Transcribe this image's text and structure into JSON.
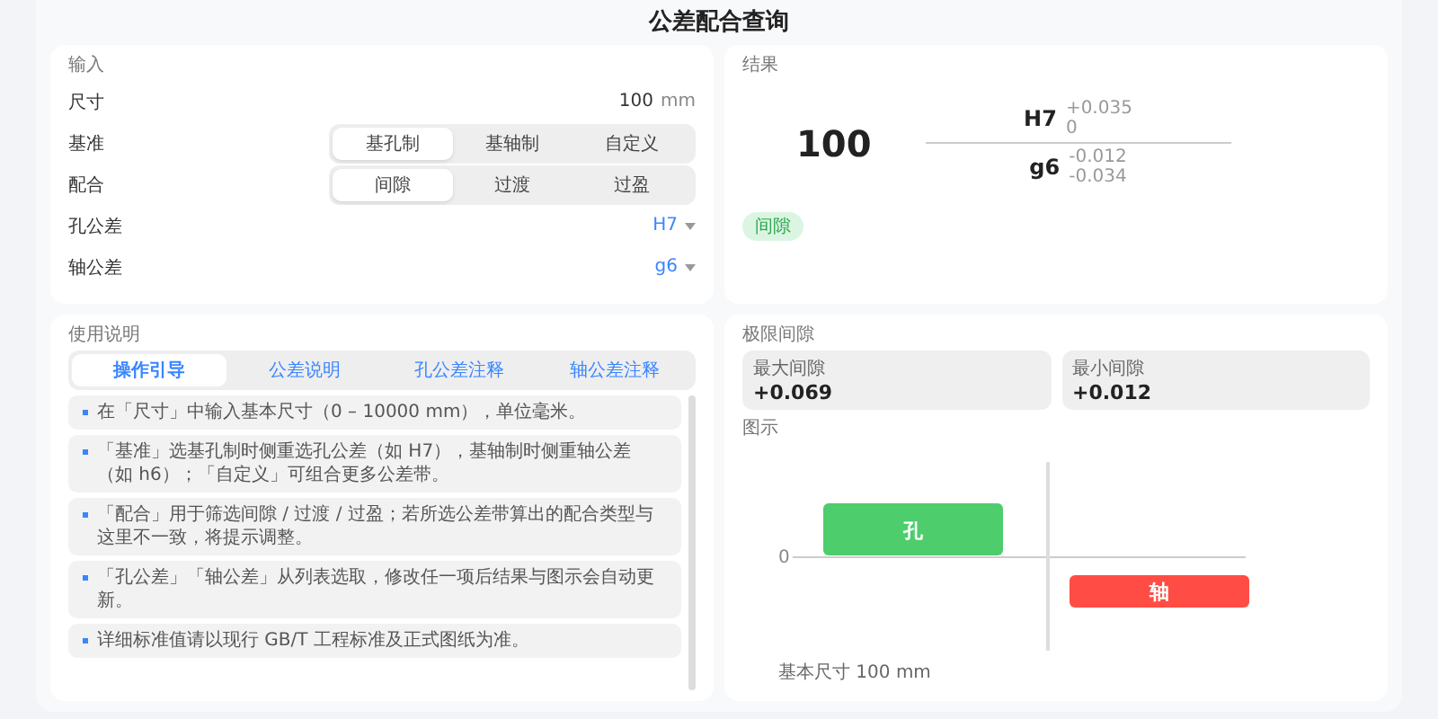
{
  "title": "公差配合查询",
  "input": {
    "label": "输入",
    "size": {
      "label": "尺寸",
      "value": "100",
      "unit": "mm"
    },
    "basis": {
      "label": "基准",
      "options": [
        {
          "label": "基孔制",
          "selected": true
        },
        {
          "label": "基轴制",
          "selected": false
        },
        {
          "label": "自定义",
          "selected": false
        }
      ]
    },
    "fit": {
      "label": "配合",
      "options": [
        {
          "label": "间隙",
          "selected": true
        },
        {
          "label": "过渡",
          "selected": false
        },
        {
          "label": "过盈",
          "selected": false
        }
      ]
    },
    "hole_tolerance": {
      "label": "孔公差",
      "value": "H7"
    },
    "shaft_tolerance": {
      "label": "轴公差",
      "value": "g6"
    }
  },
  "result": {
    "label": "结果",
    "size": "100",
    "hole": {
      "grade": "H7",
      "upper": "+0.035",
      "lower": "0"
    },
    "shaft": {
      "grade": "g6",
      "upper": "-0.012",
      "lower": "-0.034"
    },
    "badge": "间隙"
  },
  "help": {
    "label": "使用说明",
    "tabs": [
      {
        "label": "操作引导",
        "selected": true
      },
      {
        "label": "公差说明",
        "selected": false
      },
      {
        "label": "孔公差注释",
        "selected": false
      },
      {
        "label": "轴公差注释",
        "selected": false
      }
    ],
    "items": [
      "在「尺寸」中输入基本尺寸（0 – 10000 mm），单位毫米。",
      "「基准」选基孔制时侧重选孔公差（如 H7），基轴制时侧重轴公差（如 h6）；「自定义」可组合更多公差带。",
      "「配合」用于筛选间隙 / 过渡 / 过盈；若所选公差带算出的配合类型与这里不一致，将提示调整。",
      "「孔公差」「轴公差」从列表选取，修改任一项后结果与图示会自动更新。",
      "详细标准值请以现行 GB/T 工程标准及正式图纸为准。"
    ]
  },
  "limits": {
    "label": "极限间隙",
    "cards": [
      {
        "label": "最大间隙",
        "value": "+0.069"
      },
      {
        "label": "最小间隙",
        "value": "+0.012"
      }
    ],
    "diagram": {
      "label": "图示",
      "zero": "0",
      "hole": "孔",
      "shaft": "轴",
      "caption": "基本尺寸 100 mm"
    }
  }
}
